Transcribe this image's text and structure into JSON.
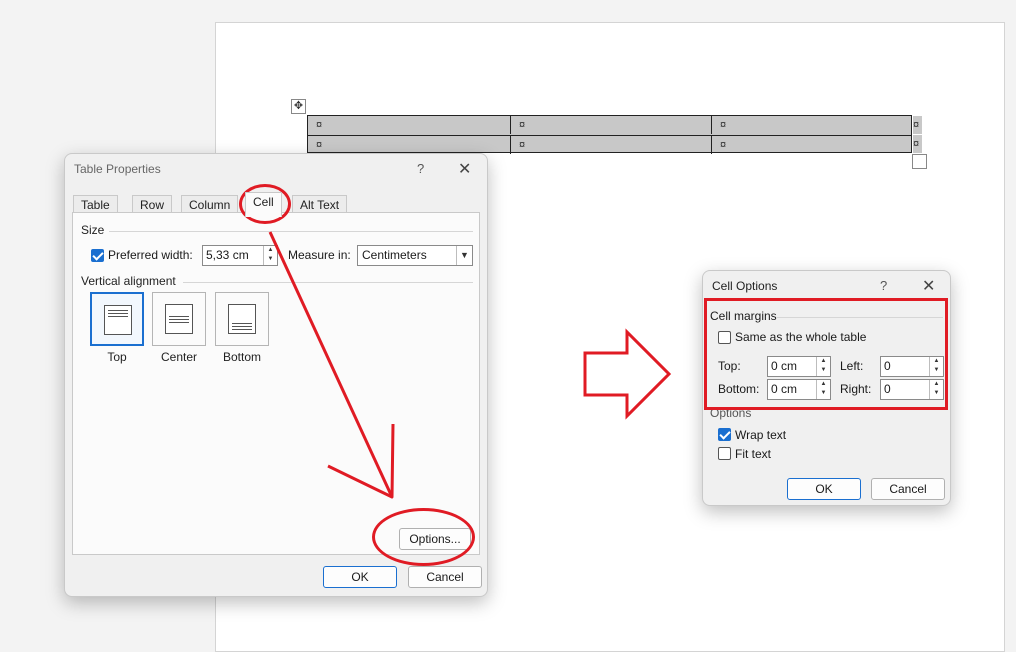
{
  "document": {
    "cell_marker": "¤",
    "move_handle_glyph": "✥"
  },
  "table_properties": {
    "title": "Table Properties",
    "help": "?",
    "close": "✕",
    "tabs": [
      "Table",
      "Row",
      "Column",
      "Cell",
      "Alt Text"
    ],
    "active_tab": "Cell",
    "size_label": "Size",
    "preferred_width_label": "Preferred width:",
    "preferred_width_checked": true,
    "preferred_width_value": "5,33 cm",
    "measure_in_label": "Measure in:",
    "measure_in_value": "Centimeters",
    "vertical_alignment_label": "Vertical alignment",
    "alignments": [
      "Top",
      "Center",
      "Bottom"
    ],
    "selected_alignment": "Top",
    "options_button": "Options...",
    "ok_button": "OK",
    "cancel_button": "Cancel"
  },
  "cell_options": {
    "title": "Cell Options",
    "help": "?",
    "close": "✕",
    "cell_margins_label": "Cell margins",
    "same_as_table_label": "Same as the whole table",
    "same_as_table_checked": false,
    "top_label": "Top:",
    "top_value": "0 cm",
    "bottom_label": "Bottom:",
    "bottom_value": "0 cm",
    "left_label": "Left:",
    "left_value": "0",
    "right_label": "Right:",
    "right_value": "0",
    "options_label": "Options",
    "wrap_text_label": "Wrap text",
    "wrap_text_checked": true,
    "fit_text_label": "Fit text",
    "fit_text_checked": false,
    "ok_button": "OK",
    "cancel_button": "Cancel"
  },
  "colors": {
    "annotation_red": "#e01b24",
    "accent_blue": "#1a6fd0"
  }
}
